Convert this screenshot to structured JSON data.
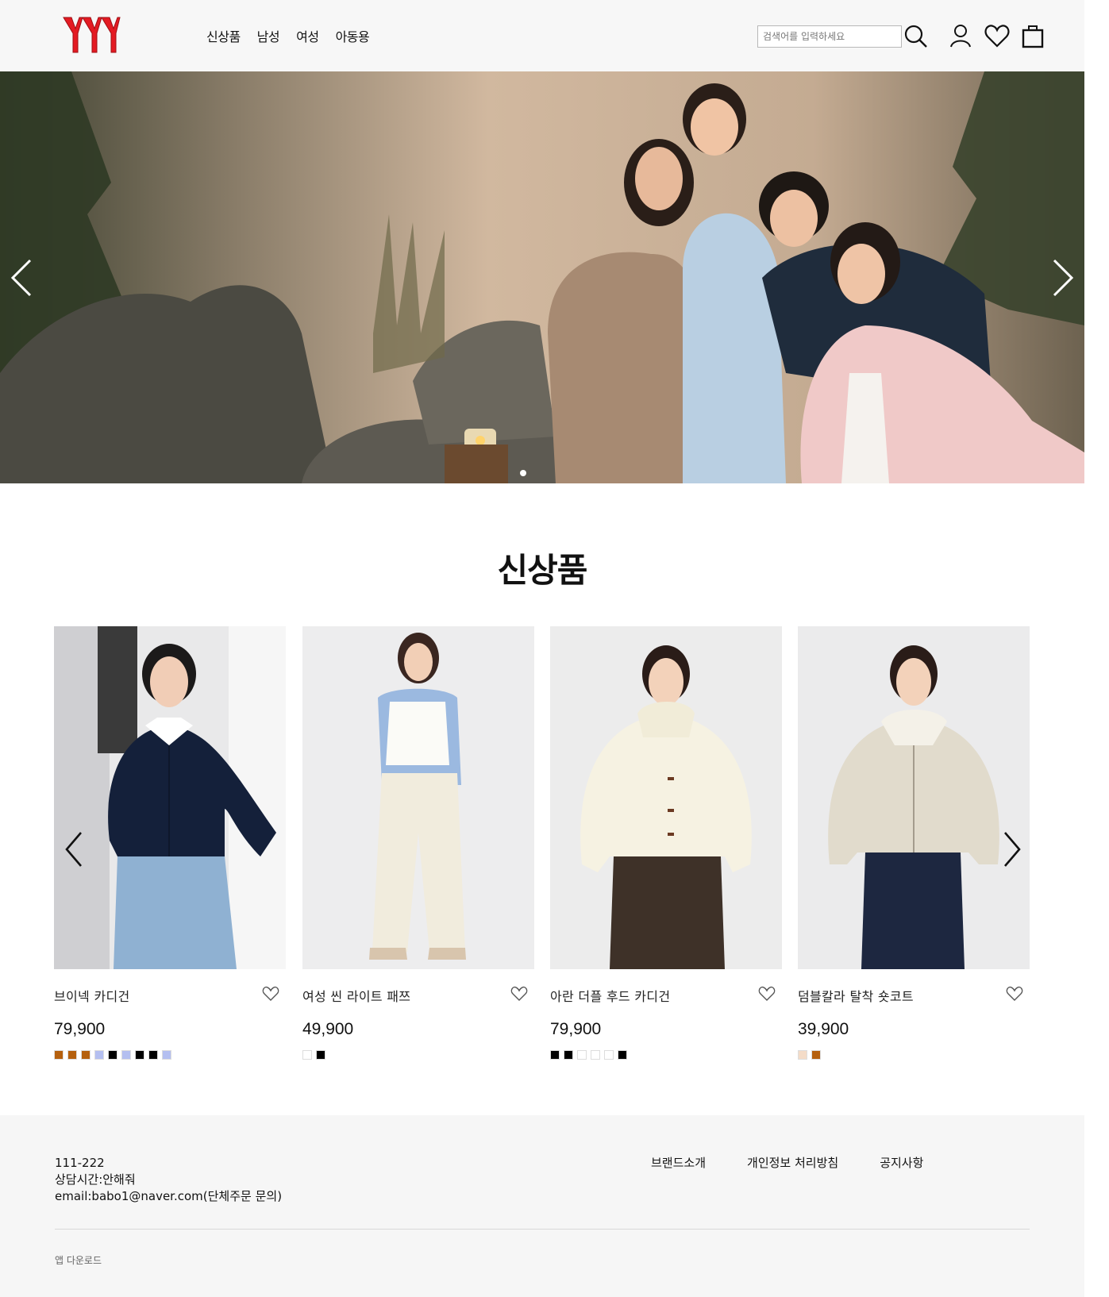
{
  "header": {
    "logo_text": "YYY",
    "nav": [
      "신상품",
      "남성",
      "여성",
      "아동용"
    ],
    "search_placeholder": "검색어를 입력하세요",
    "brand_color": "#e41b23"
  },
  "hero": {
    "slide_count": 1,
    "active_slide": 1
  },
  "new_arrivals": {
    "title": "신상품",
    "products": [
      {
        "name": "브이넥 카디건",
        "price": "79,900",
        "colors": [
          "#b5600e",
          "#b5600e",
          "#b5600e",
          "#b4bff0",
          "#000000",
          "#b4bff0",
          "#000000",
          "#000000",
          "#b4bff0"
        ]
      },
      {
        "name": "여성 씬 라이트 패쯔",
        "price": "49,900",
        "colors": [
          "#ffffff",
          "#000000"
        ]
      },
      {
        "name": "아란 더플 후드 카디건",
        "price": "79,900",
        "colors": [
          "#000000",
          "#000000",
          "#ffffff",
          "#ffffff",
          "#ffffff",
          "#000000"
        ]
      },
      {
        "name": "덤블칼라 탈착 숏코트",
        "price": "39,900",
        "colors": [
          "#f4dcc8",
          "#b5600e"
        ]
      }
    ]
  },
  "footer": {
    "phone": "111-222",
    "hours": "상담시간:안해줘",
    "email": "email:babo1@naver.com(단체주문 문의)",
    "links": [
      "브랜드소개",
      "개인정보 처리방침",
      "공지사항"
    ],
    "app_download": "앱 다운로드"
  }
}
